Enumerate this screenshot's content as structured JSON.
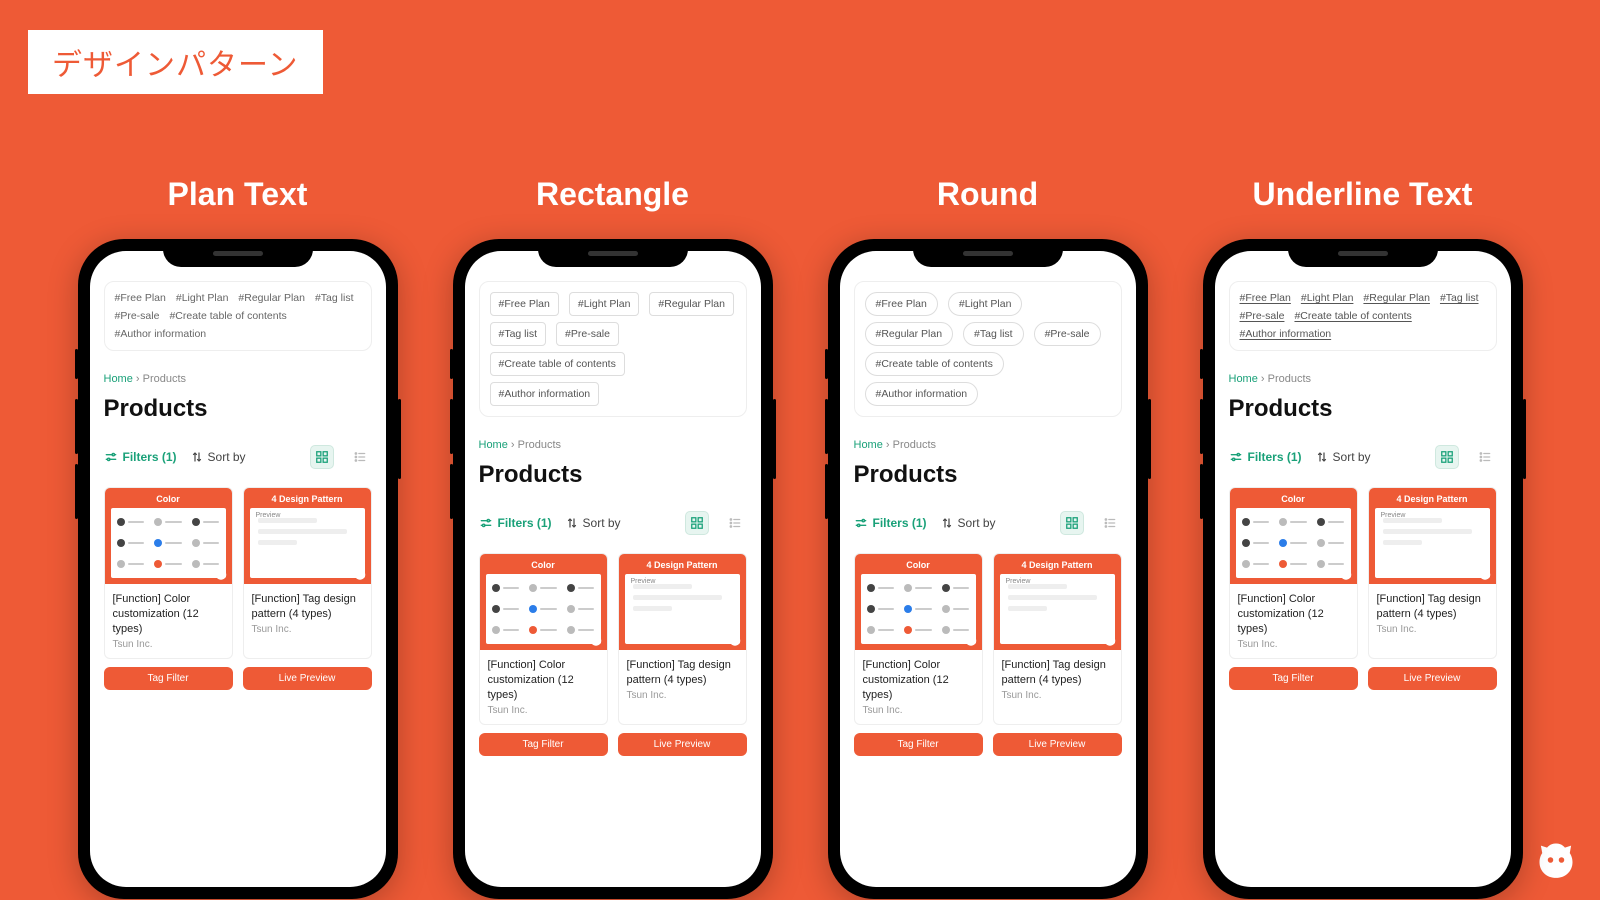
{
  "slide_label": "デザインパターン",
  "columns": [
    {
      "title": "Plan Text",
      "tag_style": "plain"
    },
    {
      "title": "Rectangle",
      "tag_style": "rect"
    },
    {
      "title": "Round",
      "tag_style": "round"
    },
    {
      "title": "Underline Text",
      "tag_style": "underline"
    }
  ],
  "tags": [
    "#Free Plan",
    "#Light Plan",
    "#Regular Plan",
    "#Tag list",
    "#Pre-sale",
    "#Create table of contents",
    "#Author information"
  ],
  "breadcrumb": {
    "home": "Home",
    "sep": "›",
    "current": "Products"
  },
  "page_title": "Products",
  "toolbar": {
    "filters": "Filters (1)",
    "sort": "Sort by"
  },
  "products": [
    {
      "thumb_title": "Color",
      "title": "[Function] Color customization (12 types)",
      "vendor": "Tsun Inc."
    },
    {
      "thumb_title": "4 Design Pattern",
      "title": "[Function] Tag design pattern (4 types)",
      "vendor": "Tsun Inc."
    }
  ],
  "stubs": [
    "Tag Filter",
    "Live Preview"
  ],
  "thumb_preview_label": "Preview"
}
